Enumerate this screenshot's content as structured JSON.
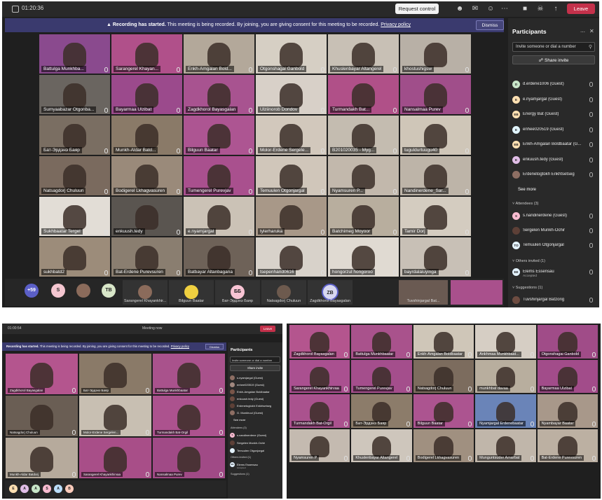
{
  "main": {
    "timer": "01:20:36",
    "request_control": "Request control",
    "leave": "Leave",
    "banner": {
      "bold": "Recording has started.",
      "text": "This meeting is being recorded. By joining, you are giving consent for this meeting to be recorded.",
      "link": "Privacy policy",
      "dismiss": "Dismiss"
    },
    "tiles": [
      {
        "name": "Battulga Munkhba...",
        "bg": "#8a4a8e"
      },
      {
        "name": "Sarangerel Khayan...",
        "bg": "#b0508a"
      },
      {
        "name": "Enkh-Amgalan Bold...",
        "bg": "#b3a89a"
      },
      {
        "name": "Otgonshagai Ganbold",
        "bg": "#d6cfc4"
      },
      {
        "name": "Khuslenbayar Altangerel",
        "bg": "#c8c0b5"
      },
      {
        "name": "khostushigsw",
        "bg": "#b8b0a6"
      },
      {
        "name": "Sumyaabazar Otgonba...",
        "bg": "#6a6560"
      },
      {
        "name": "Bayarmaa Ulzibat",
        "bg": "#9b4a8c"
      },
      {
        "name": "Zagdkhorol Bayasgalan",
        "bg": "#a85390"
      },
      {
        "name": "Ulziinorob Dondov",
        "bg": "#d8d0c8"
      },
      {
        "name": "Turmandakh Bat...",
        "bg": "#b05088"
      },
      {
        "name": "Nansalmaa Purev",
        "bg": "#a04e8a"
      },
      {
        "name": "Бат-Эрдэнэ Баяр",
        "bg": "#7a6e62"
      },
      {
        "name": "Munkh-Aldar Batd...",
        "bg": "#8a7a68"
      },
      {
        "name": "Bilguun Baatar",
        "bg": "#ad5592"
      },
      {
        "name": "Molor-Erdene Sergele...",
        "bg": "#d2c8bc"
      },
      {
        "name": "B201020035 - Myg...",
        "bg": "#c4bcb0"
      },
      {
        "name": "tuguldurtuugu40",
        "bg": "#cfc6b8"
      },
      {
        "name": "Natsagdorj Chuluun",
        "bg": "#7a6a5e"
      },
      {
        "name": "Bodigerel Lkhagvasuren",
        "bg": "#9a8a7a"
      },
      {
        "name": "Tumengerel Purevjav",
        "bg": "#a9508e"
      },
      {
        "name": "Temuulen Otgonjargal",
        "bg": "#d0c6ba"
      },
      {
        "name": "Nyamsuren P...",
        "bg": "#c2b8ac"
      },
      {
        "name": "Nandinerdene_Sar...",
        "bg": "#bdb4a8"
      },
      {
        "name": "Sukhbaatar Tergel",
        "bg": "#e2ddd6"
      },
      {
        "name": "enkuush.tedy",
        "bg": "#5a5550"
      },
      {
        "name": "e.nyamjargal",
        "bg": "#cbc2b6"
      },
      {
        "name": "tylerharuka",
        "bg": "#a89888"
      },
      {
        "name": "Batchimeg Moyoor",
        "bg": "#b8ae9e"
      },
      {
        "name": "Tamir Dorj",
        "bg": "#d4ccc0"
      },
      {
        "name": "sukhbatd2",
        "bg": "#9c8c7a"
      },
      {
        "name": "Bat-Erdene Purevsuren",
        "bg": "#8a7e70"
      },
      {
        "name": "Batbayar Altanbagana",
        "bg": "#6e6258"
      },
      {
        "name": "tsepenhand0616",
        "bg": "#d8d2ca"
      },
      {
        "name": "hongorzul hongoroo",
        "bg": "#e0dad2"
      },
      {
        "name": "bayrdalaiuyinga",
        "bg": "#c8c0b6"
      }
    ],
    "bottom_bar": {
      "overflow": "+59",
      "avatars": [
        {
          "initials": "S",
          "color": "#f4c6d0"
        },
        {
          "initials": "",
          "color": "#8b6b5b"
        },
        {
          "initials": "TB",
          "color": "#d8e6c8"
        }
      ],
      "tiles": [
        {
          "name": "Sarangerel Khayankhir..."
        },
        {
          "name": "Bilguun Baatar"
        },
        {
          "name": "Бат-Эрдэнэ Баяр"
        },
        {
          "name": "Natsagdorj Chuluun"
        },
        {
          "name": "Zagdkhorol Bayasgalan"
        },
        {
          "name": "Tuvshinjargal Bat..."
        }
      ],
      "bat_initials": "ББ",
      "zb_initials": "ZB"
    },
    "panel": {
      "title": "Participants",
      "search_placeholder": "Invite someone or dial a number",
      "share_invite": "Share invite",
      "participants": [
        {
          "initials": "D",
          "name": "d.erdene1006 (Guest)",
          "color": "#c8e6c9"
        },
        {
          "initials": "E",
          "name": "e.nyamjargal (Guest)",
          "color": "#ffe0b2"
        },
        {
          "initials": "EB",
          "name": "Energy Bat (Guest)",
          "color": "#ffe0b2"
        },
        {
          "initials": "E",
          "name": "enhee020519 (Guest)",
          "color": "#e1f5fe"
        },
        {
          "initials": "EB",
          "name": "Enkh-Amgalan Boldbaatar (G...",
          "color": "#ffe0b2"
        },
        {
          "initials": "E",
          "name": "enkuush.tedy (Guest)",
          "color": "#e1bee7"
        },
        {
          "initials": "",
          "name": "Erdenetogtokh Enkhtsetseg",
          "color": "#8d6e63"
        }
      ],
      "see_more": "See more",
      "attendees_label": "Attendees (3)",
      "attendees": [
        {
          "initials": "S",
          "name": "s.nandinerdene (Guest)",
          "color": "#f8bbd0"
        },
        {
          "initials": "",
          "name": "Sergelen Munkh-Ochir",
          "color": "#5d4037"
        },
        {
          "initials": "TO",
          "name": "Temuulen Otgonjargal",
          "color": "#e3f2fd"
        }
      ],
      "others_label": "Others invited (1)",
      "others": [
        {
          "initials": "EE",
          "name": "Elems Essensau",
          "sub": "Accepted",
          "color": "#e3f2fd"
        }
      ],
      "suggestions_label": "Suggestions (1)",
      "suggestions": [
        {
          "initials": "",
          "name": "Tuvshinjargal Batzorig",
          "color": "#6d4c41"
        }
      ]
    }
  },
  "bottom_left": {
    "timer": "01:00:54",
    "title": "Meeting now",
    "leave": "Leave",
    "banner": {
      "bold": "Recording has started.",
      "text": "This meeting is being recorded. By joining, you are giving consent for this meeting to be recorded.",
      "link": "Privacy policy",
      "dismiss": "Dismiss"
    },
    "tiles": [
      {
        "name": "Zagdkhorol Bayasgalan",
        "bg": "#b4558e"
      },
      {
        "name": "Бат-Эрдэнэ Баяр",
        "bg": "#8a7a68"
      },
      {
        "name": "Battulga Munkhbaatar",
        "bg": "#a9528c"
      },
      {
        "name": "Natsagdorj Chuluun",
        "bg": "#6a5e54"
      },
      {
        "name": "Molor-Erdene Sergelen...",
        "bg": "#c8bfb2"
      },
      {
        "name": "Turmandakh Bat-Orgil",
        "bg": "#ac528e"
      },
      {
        "name": "Munkh-Aldar Batdorj",
        "bg": "#b6aa9c"
      },
      {
        "name": "Sarangerel Khayankhirvaa",
        "bg": "#a84e88"
      },
      {
        "name": "Nansalmaa Purev",
        "bg": "#a04a86"
      }
    ],
    "bottom_avatars": [
      {
        "initials": "E",
        "color": "#ffe0b2"
      },
      {
        "initials": "A",
        "color": "#e1bee7"
      },
      {
        "initials": "A",
        "color": "#c8e6c9"
      },
      {
        "initials": "S",
        "color": "#f8bbd0"
      },
      {
        "initials": "A",
        "color": "#bbdefb"
      },
      {
        "initials": "B",
        "color": "#ffccbc"
      }
    ],
    "panel": {
      "title": "Participants",
      "search_placeholder": "Invite someone or dial a number",
      "share_invite": "Share invite",
      "participants": [
        {
          "initials": "",
          "name": "s.nyamjargal (Guest)",
          "color": "#8d6e63"
        },
        {
          "initials": "",
          "name": "enhee020519 (Guest)",
          "color": "#a1887f"
        },
        {
          "initials": "",
          "name": "Enkh-Amgalan Boldbaatar",
          "color": "#795548"
        },
        {
          "initials": "",
          "name": "enkuush.tedy (Guest)",
          "color": "#6d4c41"
        },
        {
          "initials": "",
          "name": "Erdenetogtokh Enkhtsetseg",
          "color": "#5d4037"
        },
        {
          "initials": "",
          "name": "G. Munkhuul (Guest)",
          "color": "#8d6e63"
        }
      ],
      "see_more": "See more",
      "attendees_label": "Attendees (3)",
      "attendees": [
        {
          "initials": "S",
          "name": "s.nandinerdene (Guest)",
          "color": "#f8bbd0"
        },
        {
          "initials": "",
          "name": "Sergelen Munkh-Ochir",
          "color": "#5d4037"
        },
        {
          "initials": "",
          "name": "Temuulen Otgonjargal",
          "color": "#e3f2fd"
        }
      ],
      "others_label": "Others invited (1)",
      "others": [
        {
          "initials": "EE",
          "name": "Elems Essensau",
          "sub": "Accepted",
          "color": "#e3f2fd"
        }
      ],
      "suggestions_label": "Suggestions (1)"
    }
  },
  "bottom_right": {
    "tiles": [
      {
        "name": "Zagdkhorol Bayasgalan",
        "bg": "#b4558e"
      },
      {
        "name": "Battulga Munkhbaatar",
        "bg": "#a9528c"
      },
      {
        "name": "Enkh-Amgalan Boldbaatar",
        "bg": "#cfc6b8"
      },
      {
        "name": "Ankhmaa Munkhbaat...",
        "bg": "#d6cec4"
      },
      {
        "name": "Otgonshagai Ganbold",
        "bg": "#a04c88"
      },
      {
        "name": "Sarangerel Khayankhirvaa",
        "bg": "#aa5090"
      },
      {
        "name": "Tumengerel Purevjav",
        "bg": "#a44e8c"
      },
      {
        "name": "Natsagdorj Chuluun",
        "bg": "#7c6c5e"
      },
      {
        "name": "munkhbat davaa",
        "bg": "#b8ae9e"
      },
      {
        "name": "Bayarmaa Ulzibat",
        "bg": "#a24c8a"
      },
      {
        "name": "Turmandakh Bat-Orgil",
        "bg": "#aa528e"
      },
      {
        "name": "Бат-Эрдэнэ Баяр",
        "bg": "#8c7c6a"
      },
      {
        "name": "Bilguun Baatar",
        "bg": "#ac5490"
      },
      {
        "name": "Nyamjargal Erdenebaatar",
        "bg": "#6a84b8"
      },
      {
        "name": "Nyambayar Baatar",
        "bg": "#a8988a"
      },
      {
        "name": "Nyamsuren P",
        "bg": "#c4bab0"
      },
      {
        "name": "Khuslenbayar Altangerel",
        "bg": "#cec6bc"
      },
      {
        "name": "Bodigerel Lkhagvasuren",
        "bg": "#a09080"
      },
      {
        "name": "Munguntsuder Amarbat",
        "bg": "#c0b6aa"
      },
      {
        "name": "Bat-Erdene Purevsuren",
        "bg": "#bcb0a2"
      }
    ]
  }
}
